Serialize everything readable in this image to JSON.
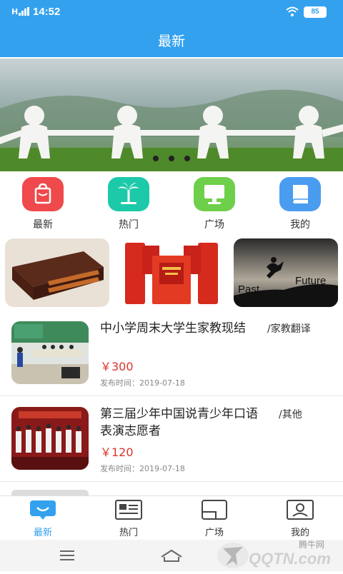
{
  "status_bar": {
    "signal": "H",
    "time": "14:52",
    "battery": "85"
  },
  "header": {
    "title": "最新"
  },
  "categories": [
    {
      "label": "最新",
      "icon": "shopping-bag-icon",
      "color": "#f0494b"
    },
    {
      "label": "热门",
      "icon": "palm-tree-icon",
      "color": "#1cc9a9"
    },
    {
      "label": "广场",
      "icon": "monitor-icon",
      "color": "#6ecf4a"
    },
    {
      "label": "我的",
      "icon": "book-icon",
      "color": "#4a9cf0"
    }
  ],
  "promos": [
    {
      "name": "tea-gift-box"
    },
    {
      "name": "red-gift-boxes"
    },
    {
      "name": "past-future-jump",
      "text_left": "Past",
      "text_right": "Future"
    }
  ],
  "listings": [
    {
      "title": "中小学周末大学生家教现结",
      "category": "/家教翻译",
      "price": "￥300",
      "date": "发布时间：2019-07-18"
    },
    {
      "title": "第三届少年中国说青少年口语表演志愿者",
      "category": "/其他",
      "price": "￥120",
      "date": "发布时间：2019-07-18"
    }
  ],
  "tabs": [
    {
      "label": "最新",
      "icon": "chat-bubble-icon",
      "active": true
    },
    {
      "label": "热门",
      "icon": "news-card-icon",
      "active": false
    },
    {
      "label": "广场",
      "icon": "square-window-icon",
      "active": false
    },
    {
      "label": "我的",
      "icon": "user-card-icon",
      "active": false
    }
  ],
  "colors": {
    "primary": "#33a1ee",
    "price": "#d9342b",
    "inactive": "#333333"
  },
  "watermark": {
    "brand": "腾牛网",
    "text": "QQTN.com"
  }
}
